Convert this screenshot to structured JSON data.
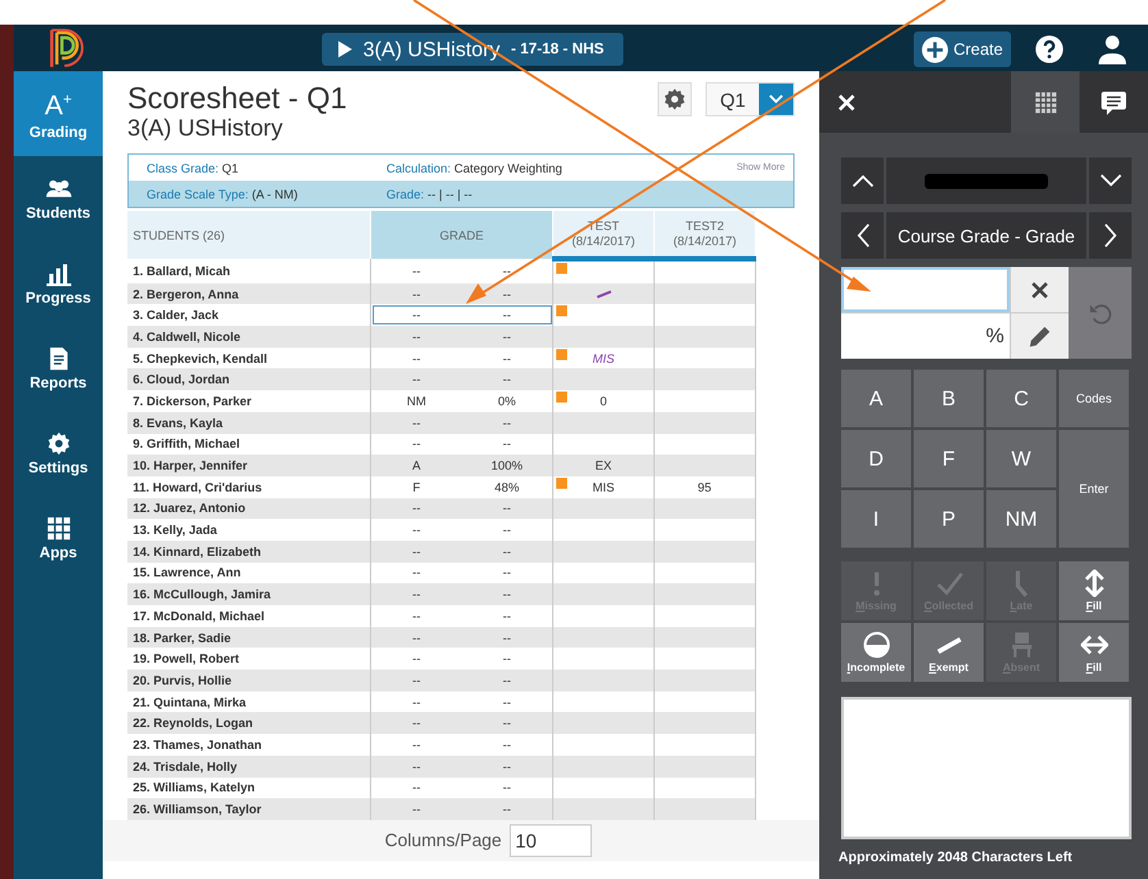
{
  "header": {
    "course": {
      "name": "3(A) USHistory",
      "detail": "- 17-18 - NHS"
    },
    "create": "Create"
  },
  "sidebar": {
    "items": [
      {
        "label": "Grading",
        "kind": "grade",
        "glyph": "A$^{+}$",
        "selected": true
      },
      {
        "label": "Students",
        "kind": "people",
        "selected": false
      },
      {
        "label": "Progress",
        "kind": "chart",
        "selected": false
      },
      {
        "label": "Reports",
        "kind": "document",
        "selected": false
      },
      {
        "label": "Settings",
        "kind": "gear",
        "selected": false
      },
      {
        "label": "Apps",
        "kind": "grid",
        "selected": false
      }
    ]
  },
  "scoresheet": {
    "title": "Scoresheet - Q1",
    "subtitle": "3(A) USHistory",
    "term": "Q1",
    "info": {
      "class_grade_label": "Class Grade:",
      "class_grade": "Q1",
      "calculation_label": "Calculation:",
      "calculation": "Category Weighting",
      "show_more": "Show More",
      "scale_label": "Grade Scale Type:",
      "scale": "(A - NM)",
      "grade_label": "Grade:",
      "grade": "-- | -- | --"
    },
    "columns": {
      "students": "STUDENTS (26)",
      "grade": "GRADE",
      "tests": [
        {
          "name": "TEST",
          "date": "(8/14/2017)"
        },
        {
          "name": "TEST2",
          "date": "(8/14/2017)"
        }
      ]
    },
    "rows": [
      {
        "name": "1. Ballard, Micah",
        "letter": "--",
        "percent": "--",
        "flag": true,
        "selected": false
      },
      {
        "name": "2. Bergeron, Anna",
        "letter": "--",
        "percent": "--",
        "flag": false,
        "selected": false,
        "test": {
          "kind": "exempt"
        }
      },
      {
        "name": "3. Calder, Jack",
        "letter": "--",
        "percent": "--",
        "flag": true,
        "selected": true
      },
      {
        "name": "4. Caldwell, Nicole",
        "letter": "--",
        "percent": "--",
        "flag": false,
        "selected": false
      },
      {
        "name": "5. Chepkevich, Kendall",
        "letter": "--",
        "percent": "--",
        "flag": true,
        "selected": false,
        "test": {
          "kind": "code",
          "text": "MIS"
        }
      },
      {
        "name": "6. Cloud, Jordan",
        "letter": "--",
        "percent": "--",
        "flag": false,
        "selected": false
      },
      {
        "name": "7. Dickerson, Parker",
        "letter": "NM",
        "percent": "0%",
        "flag": true,
        "selected": false,
        "test": {
          "kind": "text",
          "text": "0"
        }
      },
      {
        "name": "8. Evans, Kayla",
        "letter": "--",
        "percent": "--",
        "flag": false,
        "selected": false
      },
      {
        "name": "9. Griffith, Michael",
        "letter": "--",
        "percent": "--",
        "flag": false,
        "selected": false
      },
      {
        "name": "10. Harper, Jennifer",
        "letter": "A",
        "percent": "100%",
        "flag": false,
        "selected": false,
        "test": {
          "kind": "text",
          "text": "EX"
        }
      },
      {
        "name": "11. Howard, Cri'darius",
        "letter": "F",
        "percent": "48%",
        "flag": true,
        "selected": false,
        "test": {
          "kind": "text",
          "text": "MIS"
        },
        "test2": "95"
      },
      {
        "name": "12. Juarez, Antonio",
        "letter": "--",
        "percent": "--",
        "flag": false,
        "selected": false
      },
      {
        "name": "13. Kelly, Jada",
        "letter": "--",
        "percent": "--",
        "flag": false,
        "selected": false
      },
      {
        "name": "14. Kinnard, Elizabeth",
        "letter": "--",
        "percent": "--",
        "flag": false,
        "selected": false
      },
      {
        "name": "15. Lawrence, Ann",
        "letter": "--",
        "percent": "--",
        "flag": false,
        "selected": false
      },
      {
        "name": "16. McCullough, Jamira",
        "letter": "--",
        "percent": "--",
        "flag": false,
        "selected": false
      },
      {
        "name": "17. McDonald, Michael",
        "letter": "--",
        "percent": "--",
        "flag": false,
        "selected": false
      },
      {
        "name": "18. Parker, Sadie",
        "letter": "--",
        "percent": "--",
        "flag": false,
        "selected": false
      },
      {
        "name": "19. Powell, Robert",
        "letter": "--",
        "percent": "--",
        "flag": false,
        "selected": false
      },
      {
        "name": "20. Purvis, Hollie",
        "letter": "--",
        "percent": "--",
        "flag": false,
        "selected": false
      },
      {
        "name": "21. Quintana, Mirka",
        "letter": "--",
        "percent": "--",
        "flag": false,
        "selected": false
      },
      {
        "name": "22. Reynolds, Logan",
        "letter": "--",
        "percent": "--",
        "flag": false,
        "selected": false
      },
      {
        "name": "23. Thames, Jonathan",
        "letter": "--",
        "percent": "--",
        "flag": false,
        "selected": false
      },
      {
        "name": "24. Trisdale, Holly",
        "letter": "--",
        "percent": "--",
        "flag": false,
        "selected": false
      },
      {
        "name": "25. Williams, Katelyn",
        "letter": "--",
        "percent": "--",
        "flag": false,
        "selected": false
      },
      {
        "name": "26. Williamson, Taylor",
        "letter": "--",
        "percent": "--",
        "flag": false,
        "selected": false
      }
    ],
    "columns_per_page": {
      "label": "Columns/Page",
      "value": "10"
    }
  },
  "panel": {
    "tabs": [
      {
        "kind": "grid",
        "selected": true
      },
      {
        "kind": "comment",
        "selected": false
      }
    ],
    "score_nav": "Course Grade - Grade",
    "grade_field": {
      "focused": true
    },
    "percent_suffix": "%",
    "keypad": [
      {
        "label": "A",
        "kind": "grade"
      },
      {
        "label": "B",
        "kind": "grade"
      },
      {
        "label": "C",
        "kind": "grade"
      },
      {
        "label": "Codes",
        "kind": "codes"
      },
      {
        "label": "D",
        "kind": "grade"
      },
      {
        "label": "F",
        "kind": "grade"
      },
      {
        "label": "W",
        "kind": "grade"
      },
      {
        "label": "Enter",
        "kind": "enter"
      },
      {
        "label": "I",
        "kind": "grade"
      },
      {
        "label": "P",
        "kind": "grade"
      },
      {
        "label": "NM",
        "kind": "grade"
      }
    ],
    "codes": [
      {
        "kind": "exclamation",
        "label": "Missing",
        "disabled": true
      },
      {
        "kind": "check",
        "label": "Collected",
        "disabled": true
      },
      {
        "kind": "late",
        "label": "Late",
        "disabled": true
      },
      {
        "kind": "vertical",
        "label": "Fill",
        "disabled": false
      },
      {
        "kind": "half",
        "label": "Incomplete",
        "disabled": false
      },
      {
        "kind": "slash",
        "label": "Exempt",
        "disabled": false
      },
      {
        "kind": "chair",
        "label": "Absent",
        "disabled": true
      },
      {
        "kind": "horizontal",
        "label": "Fill",
        "disabled": false
      }
    ],
    "chars_left": "Approximately 2048 Characters Left"
  }
}
